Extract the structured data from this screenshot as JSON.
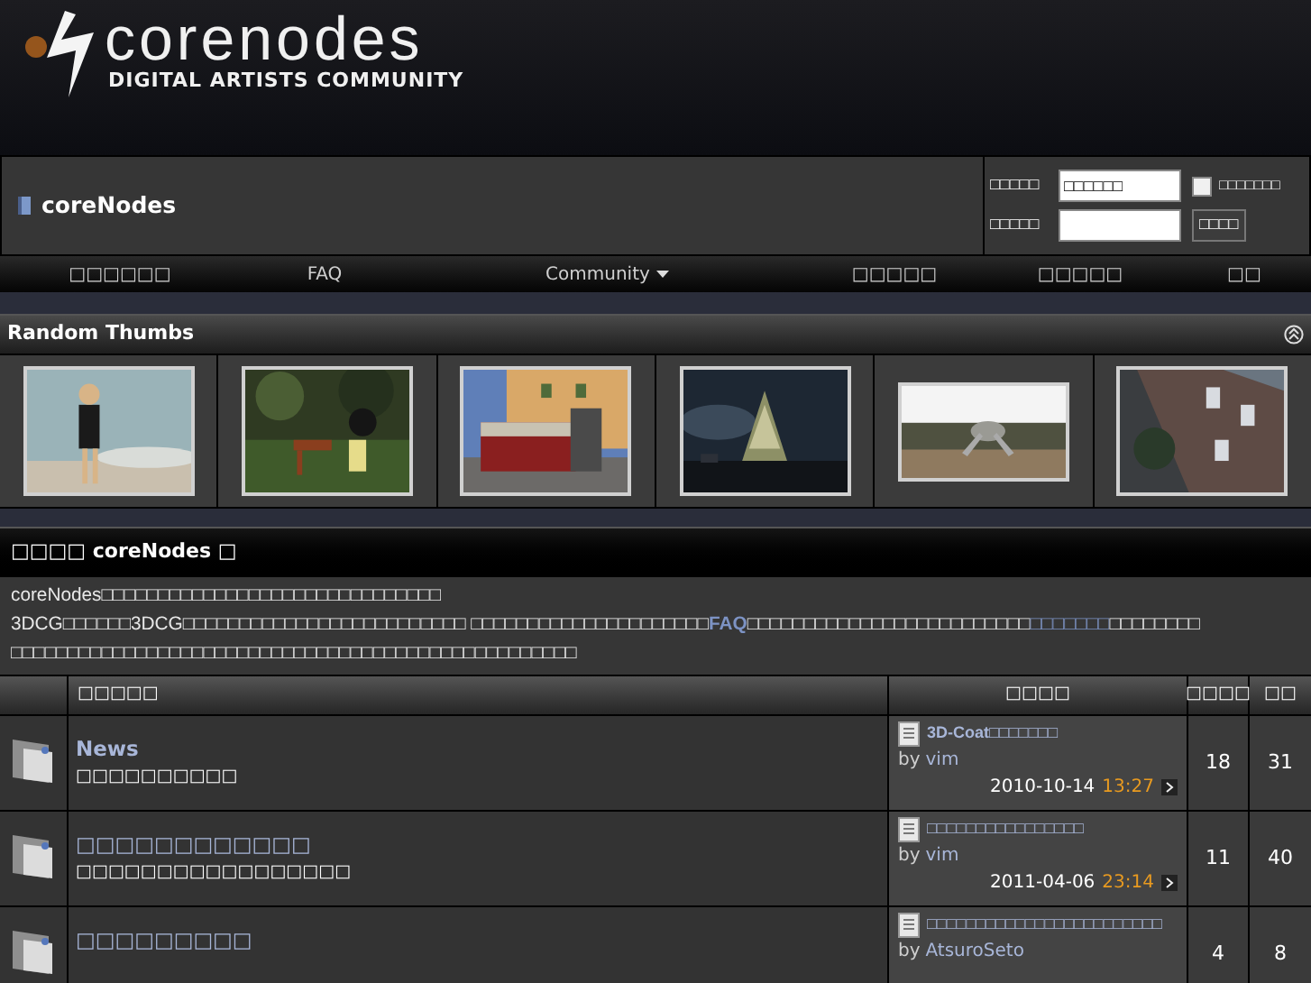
{
  "logo": {
    "name": "corenodes",
    "tagline": "DIGITAL ARTISTS COMMUNITY"
  },
  "breadcrumb": {
    "title": "coreNodes"
  },
  "login": {
    "user_label": "□□□□□",
    "user_value": "□□□□□□",
    "remember": {
      "label": "□□□□□□□",
      "checked": false
    },
    "password_label": "□□□□□",
    "button": "□□□□"
  },
  "nav": [
    {
      "label": "□□□□□□",
      "kind": "link"
    },
    {
      "label": "FAQ",
      "kind": "link"
    },
    {
      "label": "Community",
      "kind": "dropdown"
    },
    {
      "label": "□□□□□",
      "kind": "link"
    },
    {
      "label": "□□□□□",
      "kind": "link"
    },
    {
      "label": "□□",
      "kind": "link"
    }
  ],
  "random_thumbs": {
    "title": "Random Thumbs",
    "expanded": true
  },
  "welcome": {
    "title": "□□□□ coreNodes □",
    "lines": [
      [
        {
          "kind": "text",
          "text": "coreNodes□□□□□□□□□□□□□□□□□□□□□□□□□□□□□□"
        }
      ],
      [
        {
          "kind": "text",
          "text": "3DCG□□□□□□3DCG□□□□□□□□□□□□□□□□□□□□□□□□□ □□□□□□□□□□□□□□□□□□□□□"
        },
        {
          "kind": "bold_link",
          "text": "FAQ"
        },
        {
          "kind": "text",
          "text": "□□□□□□□□□□□□□□□□□□□□□□□□□"
        },
        {
          "kind": "link",
          "text": "□□□□□□□"
        },
        {
          "kind": "text",
          "text": "□□□□□□□□"
        }
      ],
      [
        {
          "kind": "text",
          "text": "□□□□□□□□□□□□□□□□□□□□□□□□□□□□□□□□□□□□□□□□□□□□□□□□□□"
        }
      ]
    ]
  },
  "table": {
    "columns": [
      "□□□□□",
      "□□□□",
      "□□□□",
      "□□"
    ],
    "rows": [
      {
        "title": "News",
        "description": "□□□□□□□□□□",
        "last_post": {
          "title": "3D-Coat□□□□□□□",
          "by": "by",
          "user": "vim",
          "date": "2010-10-14",
          "time": "13:27"
        },
        "topics": "18",
        "posts": "31"
      },
      {
        "title": "□□□□□□□□□□□□",
        "description": "□□□□□□□□□□□□□□□□□",
        "last_post": {
          "title": "□□□□□□□□□□□□□□□□",
          "by": "by",
          "user": "vim",
          "date": "2011-04-06",
          "time": "23:14"
        },
        "topics": "11",
        "posts": "40"
      },
      {
        "title": "□□□□□□□□□",
        "last_post": {
          "title": "□□□□□□□□□□□□□□□□□□□□□□□□",
          "by": "by",
          "user": "AtsuroSeto"
        },
        "topics": "4",
        "posts": "8"
      }
    ]
  }
}
